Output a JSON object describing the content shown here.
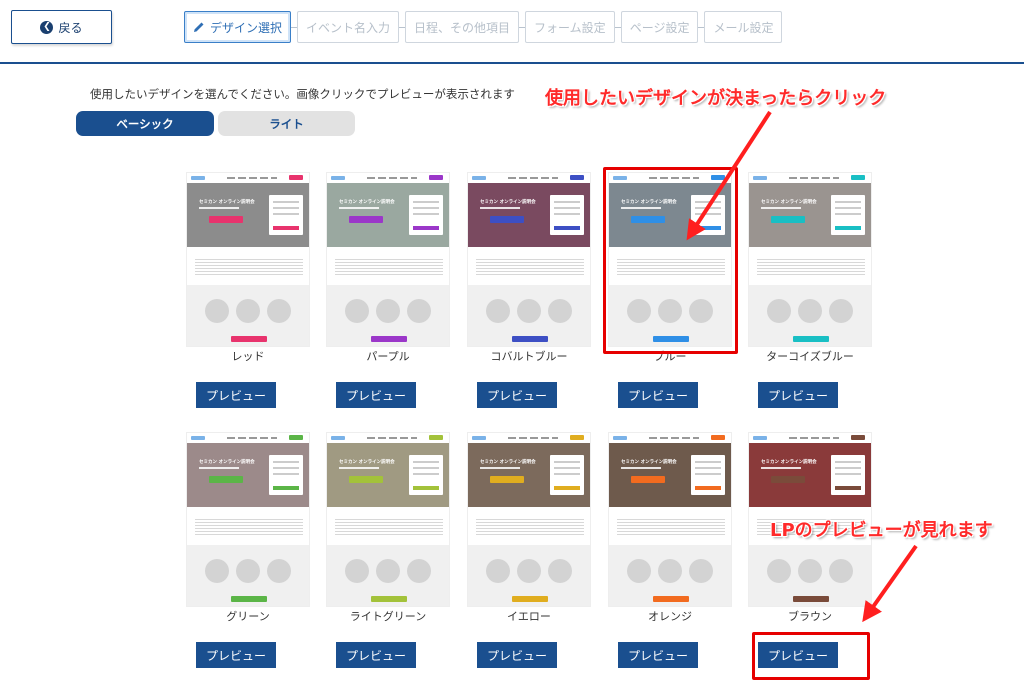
{
  "header": {
    "back_label": "戻る",
    "steps": [
      {
        "label": "デザイン選択",
        "active": true
      },
      {
        "label": "イベント名入力",
        "active": false
      },
      {
        "label": "日程、その他項目",
        "active": false
      },
      {
        "label": "フォーム設定",
        "active": false
      },
      {
        "label": "ページ設定",
        "active": false
      },
      {
        "label": "メール設定",
        "active": false
      }
    ]
  },
  "instruction": "使用したいデザインを選んでください。画像クリックでプレビューが表示されます",
  "tabs": [
    {
      "label": "ベーシック",
      "active": true
    },
    {
      "label": "ライト",
      "active": false
    }
  ],
  "annotations": {
    "top": "使用したいデザインが決まったらクリック",
    "bottom": "LPのプレビューが見れます"
  },
  "thumbnail_hero_title": "セミカン オンライン説明会",
  "designs": [
    {
      "name": "レッド",
      "accent": "#e8336d",
      "hero": "#8c8c8c",
      "preview_label": "プレビュー"
    },
    {
      "name": "パープル",
      "accent": "#9b37c9",
      "hero": "#9aa8a0",
      "preview_label": "プレビュー"
    },
    {
      "name": "コバルトブルー",
      "accent": "#3d4fc4",
      "hero": "#7a4a60",
      "preview_label": "プレビュー"
    },
    {
      "name": "ブルー",
      "accent": "#2f8fe6",
      "hero": "#7d8890",
      "preview_label": "プレビュー"
    },
    {
      "name": "ターコイズブルー",
      "accent": "#19bfc4",
      "hero": "#9a9490",
      "preview_label": "プレビュー"
    },
    {
      "name": "グリーン",
      "accent": "#5bb547",
      "hero": "#9c8a8a",
      "preview_label": "プレビュー"
    },
    {
      "name": "ライトグリーン",
      "accent": "#a3c23a",
      "hero": "#a09a82",
      "preview_label": "プレビュー"
    },
    {
      "name": "イエロー",
      "accent": "#e0ad1f",
      "hero": "#7c6a5c",
      "preview_label": "プレビュー"
    },
    {
      "name": "オレンジ",
      "accent": "#f26b1f",
      "hero": "#6e5a4c",
      "preview_label": "プレビュー"
    },
    {
      "name": "ブラウン",
      "accent": "#7a4b3a",
      "hero": "#8a3a3a",
      "preview_label": "プレビュー"
    }
  ]
}
